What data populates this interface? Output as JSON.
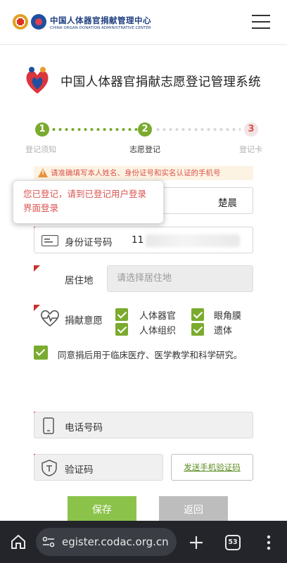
{
  "header": {
    "org_name_cn": "中国人体器官捐献管理中心",
    "org_name_en": "CHINA ORGAN DONATION ADMINISTRATIVE CENTER"
  },
  "system": {
    "title": "中国人体器官捐献志愿登记管理系统"
  },
  "stepper": {
    "steps": [
      {
        "number": "1",
        "label": "登记须知",
        "status": "done"
      },
      {
        "number": "2",
        "label": "志愿登记",
        "status": "active"
      },
      {
        "number": "3",
        "label": "登记卡",
        "status": "todo"
      }
    ]
  },
  "warning": {
    "text": "请准确填写本人姓名、身份证号和实名认证的手机号"
  },
  "tooltip": {
    "text": "您已登记，请到已登记用户登录界面登录"
  },
  "form": {
    "name_value": "楚晨",
    "id_label": "身份证号码",
    "id_value": "11",
    "address_label": "居住地",
    "address_placeholder": "请选择居住地",
    "donation_label": "捐献意愿",
    "options": [
      {
        "label": "人体器官",
        "checked": true
      },
      {
        "label": "眼角膜",
        "checked": true
      },
      {
        "label": "人体组织",
        "checked": true
      },
      {
        "label": "遗体",
        "checked": true
      }
    ],
    "consent_text": "同意捐后用于临床医疗、医学教学和科学研究。",
    "phone_label": "电话号码",
    "code_label": "验证码",
    "sms_button": "发送手机验证码"
  },
  "actions": {
    "save": "保存",
    "back": "返回"
  },
  "browser": {
    "url": "egister.codac.org.cn",
    "tab_count": "53"
  },
  "colors": {
    "accent_green": "#7aab2f",
    "required_red": "#c9302c",
    "warning_text": "#d9534f"
  }
}
